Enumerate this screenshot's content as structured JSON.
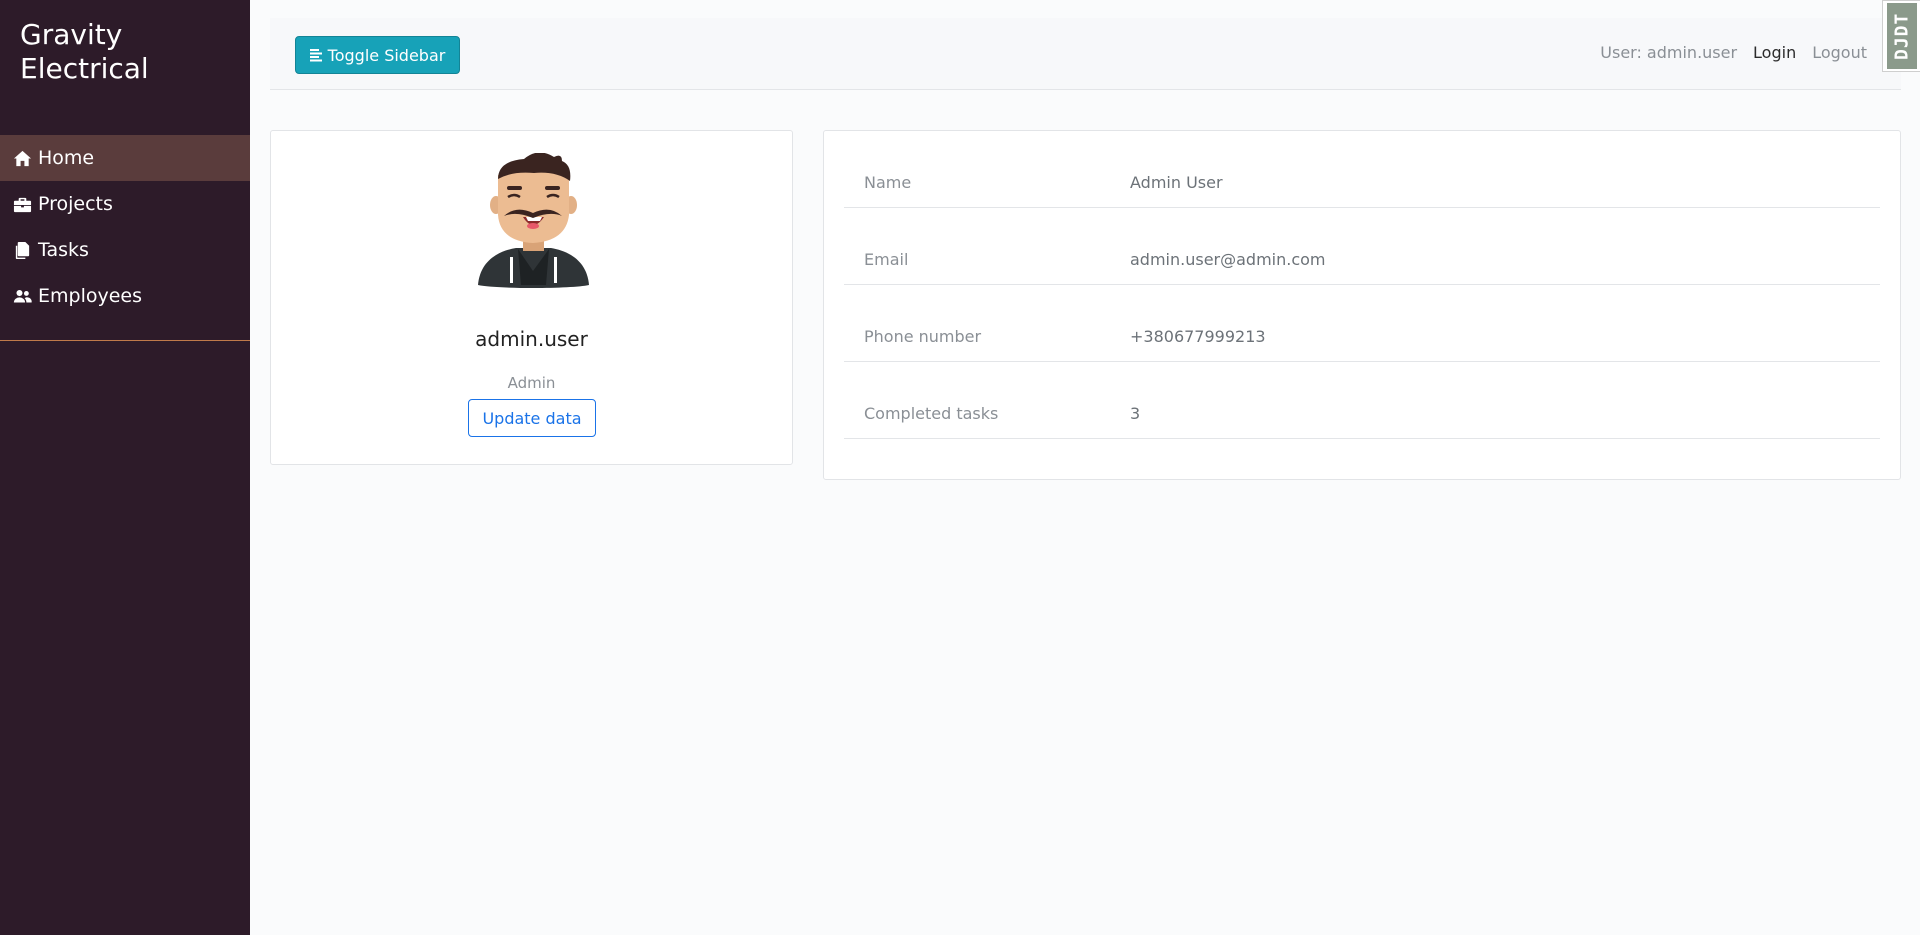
{
  "sidebar": {
    "brand": "Gravity Electrical",
    "items": [
      {
        "label": "Home",
        "icon": "home-icon",
        "active": true
      },
      {
        "label": "Projects",
        "icon": "briefcase-icon",
        "active": false
      },
      {
        "label": "Tasks",
        "icon": "copy-icon",
        "active": false
      },
      {
        "label": "Employees",
        "icon": "users-icon",
        "active": false
      }
    ]
  },
  "topbar": {
    "toggle_label": "Toggle Sidebar",
    "user_label": "User: admin.user",
    "login_label": "Login",
    "logout_label": "Logout",
    "debug_label": "DJDT"
  },
  "profile": {
    "username": "admin.user",
    "role": "Admin",
    "update_label": "Update data"
  },
  "details": [
    {
      "label": "Name",
      "value": "Admin User"
    },
    {
      "label": "Email",
      "value": "admin.user@admin.com"
    },
    {
      "label": "Phone number",
      "value": "+380677999213"
    },
    {
      "label": "Completed tasks",
      "value": "3"
    }
  ],
  "colors": {
    "sidebar_bg": "#2d1b29",
    "active_item_bg": "#5a3c3c",
    "toggle_btn": "#17a2b8",
    "update_btn": "#1a73e8"
  }
}
